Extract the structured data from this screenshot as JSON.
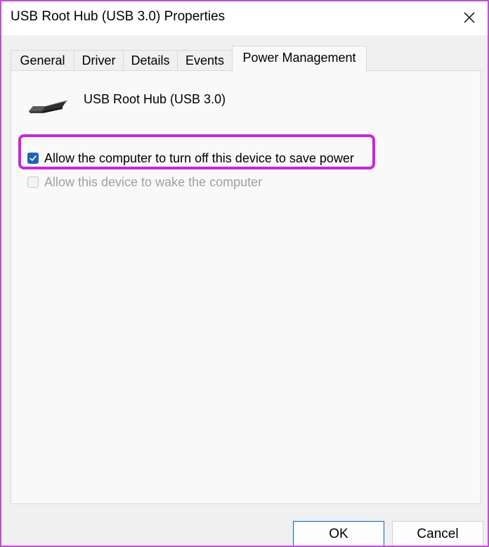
{
  "window": {
    "title": "USB Root Hub (USB 3.0) Properties",
    "close_icon": "close-icon"
  },
  "tabs": [
    {
      "label": "General",
      "active": false
    },
    {
      "label": "Driver",
      "active": false
    },
    {
      "label": "Details",
      "active": false
    },
    {
      "label": "Events",
      "active": false
    },
    {
      "label": "Power Management",
      "active": true
    }
  ],
  "device": {
    "icon": "usb-plug-icon",
    "name": "USB Root Hub (USB 3.0)"
  },
  "options": [
    {
      "label": "Allow the computer to turn off this device to save power",
      "checked": true,
      "enabled": true
    },
    {
      "label": "Allow this device to wake the computer",
      "checked": false,
      "enabled": false
    }
  ],
  "buttons": {
    "ok_label": "OK",
    "cancel_label": "Cancel"
  },
  "colors": {
    "highlight": "#c827d8",
    "checkbox_accent": "#1f64b7",
    "window_border": "#c04fd1"
  }
}
